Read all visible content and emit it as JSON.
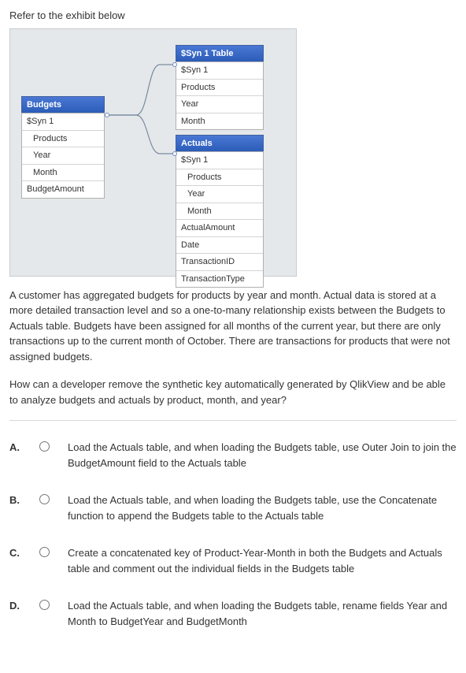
{
  "intro": "Refer to the exhibit below",
  "diagram": {
    "budgets": {
      "title": "Budgets",
      "fields": [
        "$Syn 1",
        "Products",
        "Year",
        "Month",
        "BudgetAmount"
      ],
      "indents": [
        0,
        1,
        1,
        1,
        0
      ]
    },
    "syn": {
      "title": "$Syn 1 Table",
      "fields": [
        "$Syn 1",
        "Products",
        "Year",
        "Month"
      ],
      "indents": [
        0,
        0,
        0,
        0
      ]
    },
    "actuals": {
      "title": "Actuals",
      "fields": [
        "$Syn 1",
        "Products",
        "Year",
        "Month",
        "ActualAmount",
        "Date",
        "TransactionID",
        "TransactionType"
      ],
      "indents": [
        0,
        1,
        1,
        1,
        0,
        0,
        0,
        0
      ]
    }
  },
  "narrative": "A customer has aggregated budgets for products by year and month. Actual data is stored at a more detailed transaction level and so a one-to-many relationship exists between the Budgets to Actuals table. Budgets have been assigned for all months of the current year, but there are only transactions up to the current month of October. There are transactions for products that were not assigned budgets.",
  "question": "How can a developer remove the synthetic key automatically generated by QlikView and be able to analyze budgets and actuals by product, month, and year?",
  "options": {
    "A": "Load the Actuals table, and when loading the Budgets table, use Outer Join to join the BudgetAmount field to the Actuals table",
    "B": "Load the Actuals table, and when loading the Budgets table, use the Concatenate function to append the Budgets table to the Actuals table",
    "C": "Create a concatenated key of Product-Year-Month in both the Budgets and Actuals table and comment out the individual fields in the Budgets table",
    "D": "Load the Actuals table, and when loading the Budgets table, rename fields Year and Month to BudgetYear and BudgetMonth"
  },
  "labels": {
    "A": "A.",
    "B": "B.",
    "C": "C.",
    "D": "D."
  }
}
